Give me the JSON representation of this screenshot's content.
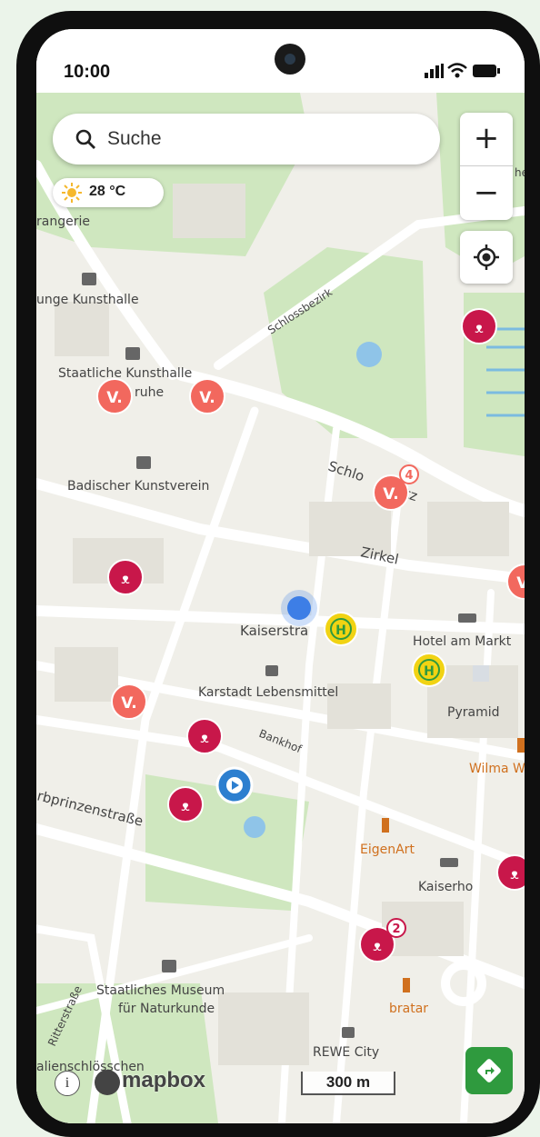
{
  "status_bar": {
    "time": "10:00"
  },
  "search": {
    "placeholder": "Suche",
    "icon": "search-icon"
  },
  "weather": {
    "temperature": "28 °C",
    "icon": "sun-icon"
  },
  "map_controls": {
    "zoom_in": "+",
    "zoom_out": "−",
    "locate_icon": "locate-icon",
    "route_icon": "directions-icon"
  },
  "map_attribution": {
    "logo": "mapbox",
    "info": "i",
    "scale": "300 m"
  },
  "map_labels": {
    "orangerie": "rangerie",
    "junge_kunsthalle": "unge Kunsthalle",
    "staatliche_kunsthalle_1": "Staatliche Kunsthalle",
    "staatliche_kunsthalle_2": "ruhe",
    "badischer_kunstverein": "Badischer Kunstverein",
    "schlossbezirk": "Schlossbezirk",
    "schlossplatz_a": "Schlo",
    "schlossplatz_b": "tz",
    "zirkel": "Zirkel",
    "kaiserstrasse": "Kaiserstra",
    "hotel_am_markt": "Hotel am Markt",
    "karstadt": "Karstadt Lebensmittel",
    "pyramid": "Pyramid",
    "wilma": "Wilma W",
    "bankhof": "Bankhof",
    "erbprinzenstrasse": "rbprinzenstraße",
    "eigenart": "EigenArt",
    "kaiserhof": "Kaiserho",
    "museum_1": "Staatliches Museum",
    "museum_2": "für Naturkunde",
    "bratar": "bratar",
    "ritterstrasse": "Ritterstraße",
    "schloesschen": "alienschlösschen",
    "rewe": "REWE City",
    "he": "he"
  },
  "markers": {
    "voi_cluster_count": "4",
    "bike_cluster_count": "2",
    "voi_letter": "V.",
    "bus_letter": "H"
  },
  "colors": {
    "bike": "#c8174a",
    "voi": "#f2685e",
    "bus": "#f1d313",
    "route_button": "#2f9a3e",
    "user_location": "#3d7ee6",
    "park": "#cfe7bf"
  }
}
